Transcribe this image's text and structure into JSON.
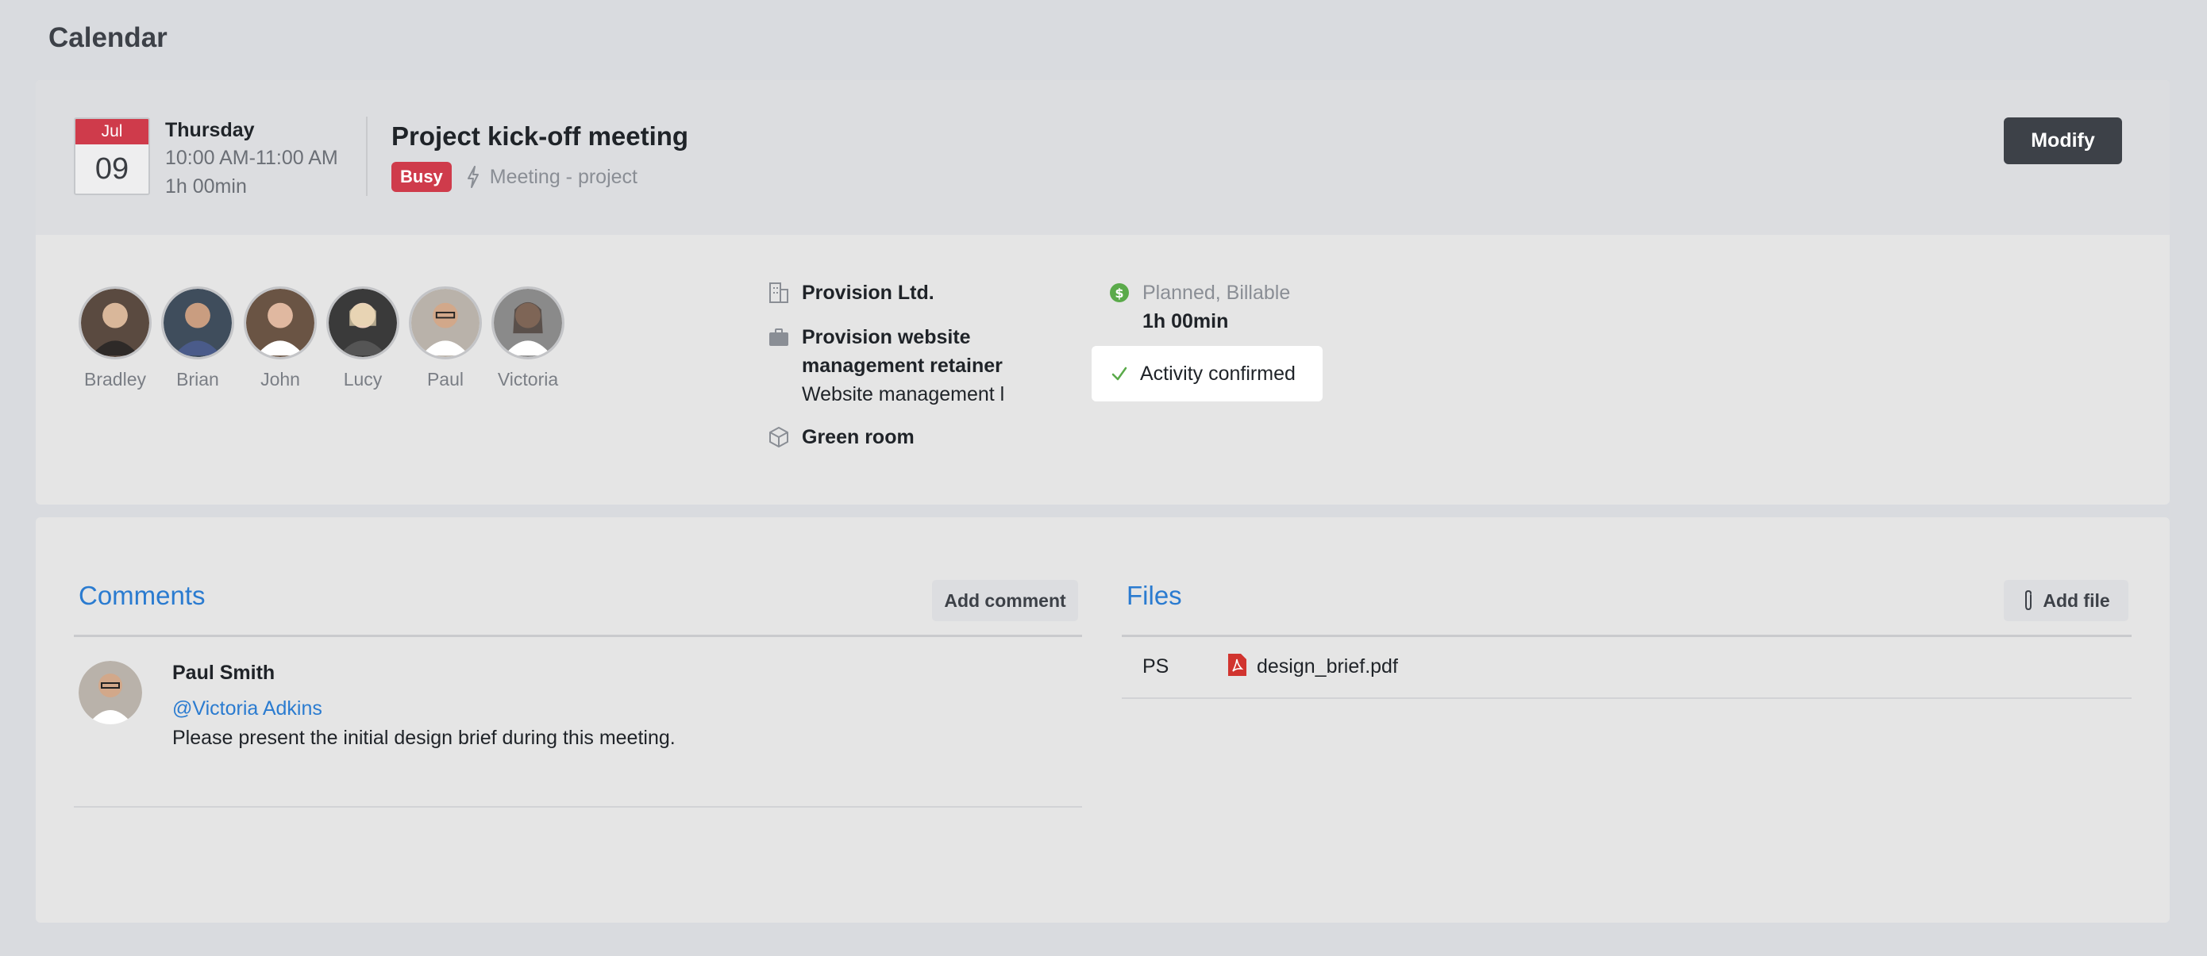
{
  "page": {
    "title": "Calendar"
  },
  "event": {
    "month": "Jul",
    "day": "09",
    "weekday": "Thursday",
    "time_range": "10:00 AM-11:00 AM",
    "duration": "1h 00min",
    "title": "Project kick-off meeting",
    "status_badge": "Busy",
    "type": "Meeting - project",
    "modify_label": "Modify",
    "participants": [
      {
        "name": "Bradley",
        "avatar_color": "#5a4a40"
      },
      {
        "name": "Brian",
        "avatar_color": "#3f4d5c"
      },
      {
        "name": "John",
        "avatar_color": "#6a5444"
      },
      {
        "name": "Lucy",
        "avatar_color": "#c9b79a"
      },
      {
        "name": "Paul",
        "avatar_color": "#7a6656"
      },
      {
        "name": "Victoria",
        "avatar_color": "#8a6a5a"
      }
    ],
    "details": {
      "company": "Provision Ltd.",
      "project_line1": "Provision website",
      "project_line2": "management retainer",
      "task": "Website management l",
      "location": "Green room"
    },
    "billing": {
      "status": "Planned, Billable",
      "duration": "1h 00min"
    },
    "confirmation": "Activity confirmed"
  },
  "comments": {
    "title": "Comments",
    "add_label": "Add comment",
    "items": [
      {
        "author": "Paul Smith",
        "mention": "@Victoria Adkins",
        "text": "Please present the initial design brief during this meeting."
      }
    ]
  },
  "files": {
    "title": "Files",
    "add_label": "Add file",
    "items": [
      {
        "owner": "PS",
        "name": "design_brief.pdf"
      }
    ]
  },
  "colors": {
    "accent": "#2a7bd0",
    "busy": "#cf3b4b",
    "dark_button": "#3d4148",
    "success": "#5aaa4a"
  }
}
